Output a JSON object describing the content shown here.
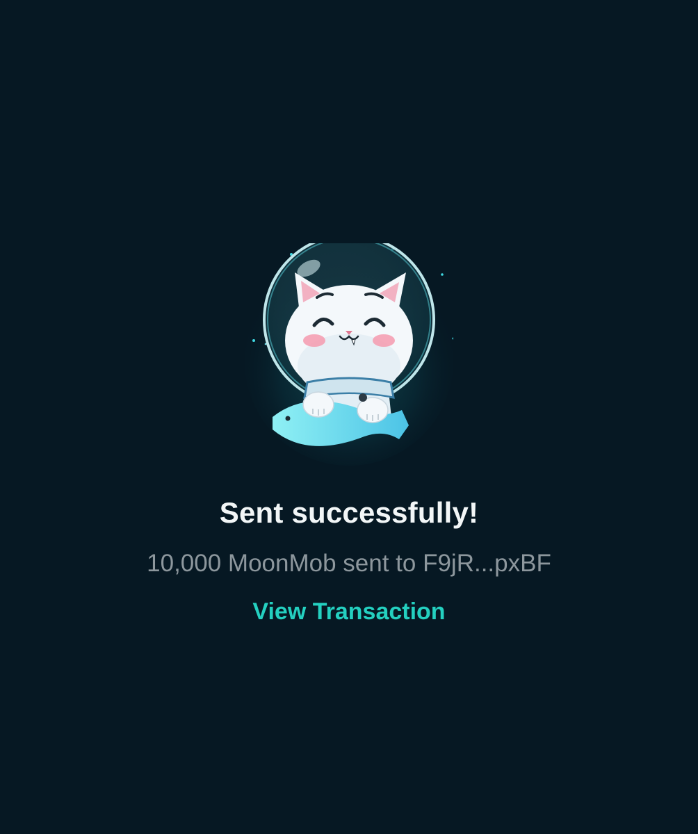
{
  "colors": {
    "background": "#061823",
    "title": "#f2f6f7",
    "subtitle": "#8d979d",
    "accent": "#24d0c0"
  },
  "illustration": {
    "icon": "astronaut-cat-icon"
  },
  "status": {
    "title": "Sent successfully!",
    "message": "10,000 MoonMob sent to F9jR...pxBF",
    "view_transaction_label": "View Transaction"
  }
}
